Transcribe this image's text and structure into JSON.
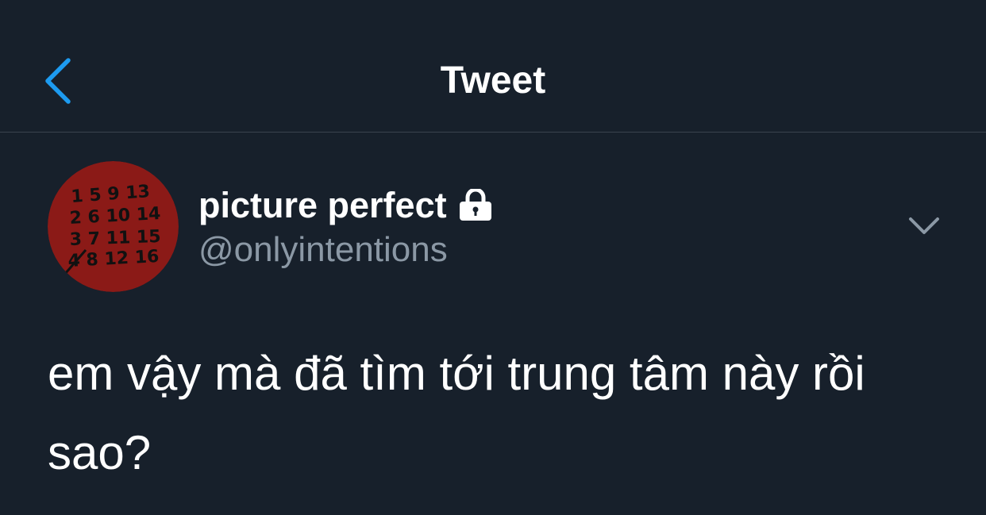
{
  "header": {
    "title": "Tweet",
    "back_icon": "chevron-left-icon",
    "accent_color": "#1d9bf0"
  },
  "tweet": {
    "author": {
      "display_name": "picture perfect",
      "handle": "@onlyintentions",
      "protected": true,
      "lock_icon": "lock-icon",
      "avatar": {
        "background_color": "#8b1a17",
        "handwritten_lines": [
          "1 5 9 13",
          "2 6 10 14",
          "3 7 11 15",
          "4 8 12 16"
        ]
      }
    },
    "menu_icon": "chevron-down-icon",
    "text": "em vậy mà đã tìm tới trung tâm này rồi\nsao?"
  },
  "colors": {
    "background": "#17202b",
    "divider": "#3a444f",
    "primary_text": "#ffffff",
    "secondary_text": "#8b98a5"
  }
}
